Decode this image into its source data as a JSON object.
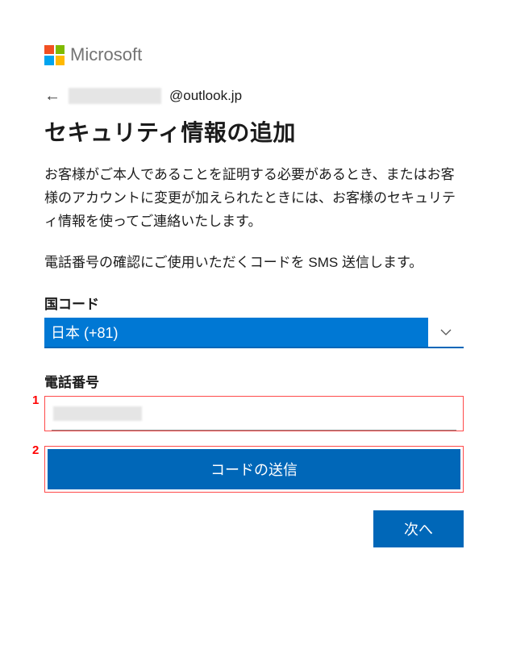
{
  "brand": {
    "name": "Microsoft"
  },
  "account": {
    "domain_suffix": "@outlook.jp"
  },
  "page": {
    "title": "セキュリティ情報の追加",
    "desc1": "お客様がご本人であることを証明する必要があるとき、またはお客様のアカウントに変更が加えられたときには、お客様のセキュリティ情報を使ってご連絡いたします。",
    "desc2": "電話番号の確認にご使用いただくコードを SMS 送信します。"
  },
  "country": {
    "label": "国コード",
    "selected": "日本 (+81)"
  },
  "phone": {
    "label": "電話番号"
  },
  "callouts": {
    "one": "1",
    "two": "2"
  },
  "buttons": {
    "send_code": "コードの送信",
    "next": "次へ"
  }
}
